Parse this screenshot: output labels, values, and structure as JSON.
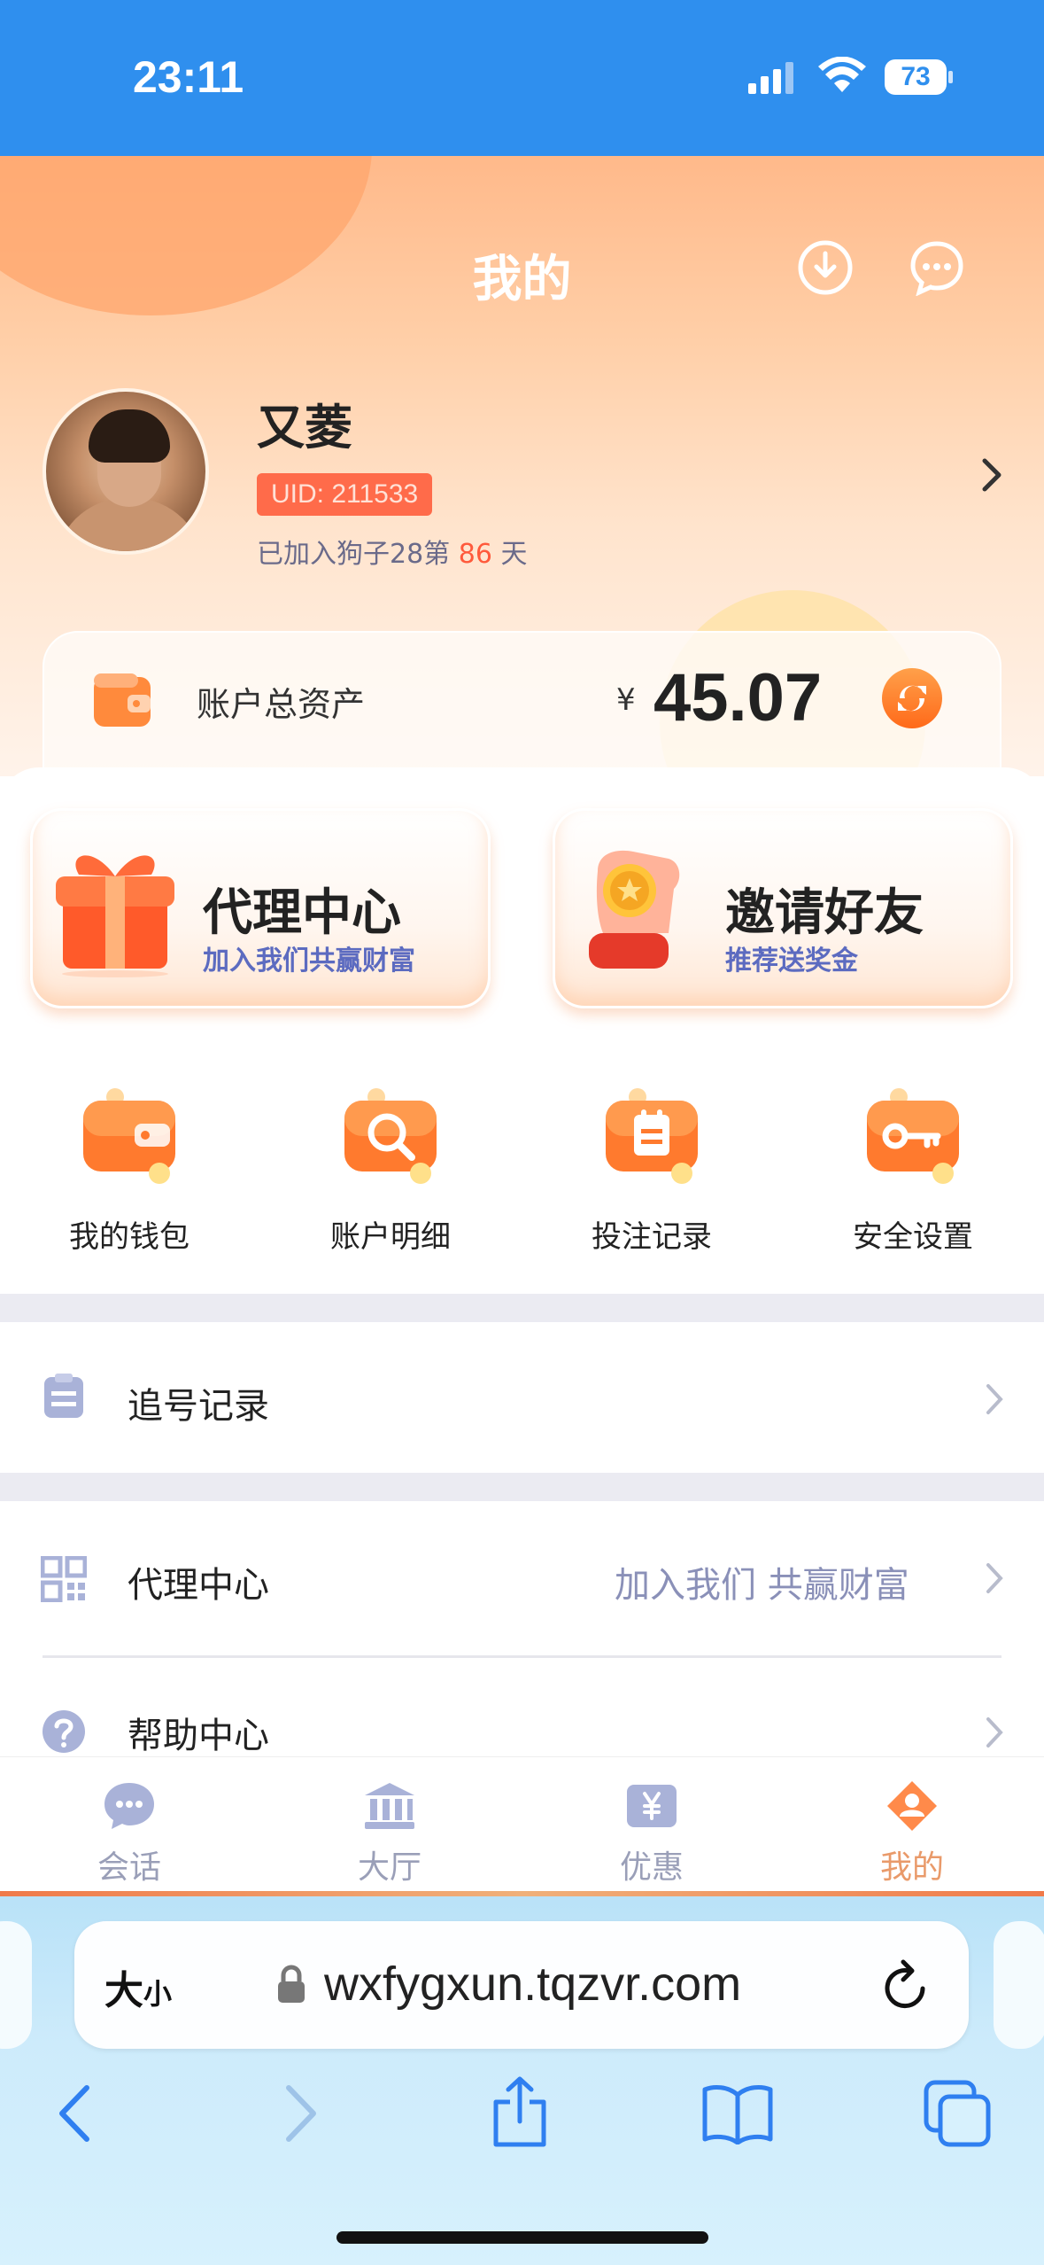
{
  "status_bar": {
    "time": "23:11",
    "battery": "73"
  },
  "header": {
    "title": "我的"
  },
  "profile": {
    "name": "又菱",
    "uid": "UID: 211533",
    "joined_prefix": "已加入狗子28第",
    "joined_days": "86",
    "joined_suffix": "天"
  },
  "balance": {
    "label": "账户总资产",
    "currency": "¥",
    "value": "45.07"
  },
  "promos": [
    {
      "title": "代理中心",
      "subtitle": "加入我们共赢财富",
      "icon": "gift-box-icon"
    },
    {
      "title": "邀请好友",
      "subtitle": "推荐送奖金",
      "icon": "hand-coin-icon"
    }
  ],
  "quick_actions": [
    {
      "label": "我的钱包",
      "icon": "wallet-icon"
    },
    {
      "label": "账户明细",
      "icon": "search-icon"
    },
    {
      "label": "投注记录",
      "icon": "notepad-icon"
    },
    {
      "label": "安全设置",
      "icon": "key-icon"
    }
  ],
  "list": {
    "chase": {
      "label": "追号记录"
    },
    "agent": {
      "label": "代理中心",
      "right": "加入我们 共赢财富"
    },
    "help": {
      "label": "帮助中心"
    }
  },
  "tabs": [
    {
      "label": "会话",
      "icon": "chat-bubble-icon",
      "active": false
    },
    {
      "label": "大厅",
      "icon": "bank-icon",
      "active": false
    },
    {
      "label": "优惠",
      "icon": "yen-ticket-icon",
      "active": false
    },
    {
      "label": "我的",
      "icon": "user-icon",
      "active": true
    }
  ],
  "browser": {
    "text_size_big": "大",
    "text_size_small": "小",
    "url": "wxfygxun.tqzvr.com"
  },
  "colors": {
    "status_bar": "#2f8fee",
    "accent": "#ff6b3a",
    "subtitle_blue": "#5c6bc0"
  }
}
